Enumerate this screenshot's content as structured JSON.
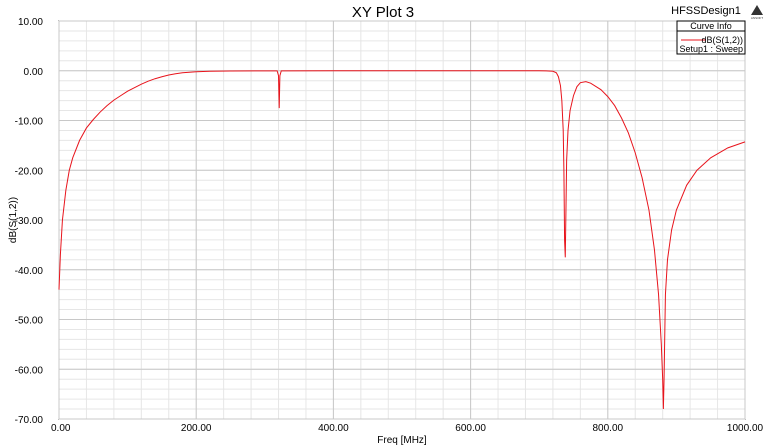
{
  "design_name": "HFSSDesign1",
  "logo_text": "ANSOFT",
  "colors": {
    "background": "#ffffff",
    "plot_bg": "#ffffff",
    "grid": "#c8c8c8",
    "curve": "#e8141c",
    "frame": "#000000"
  },
  "legend": {
    "title": "Curve Info",
    "entries": [
      {
        "name": "dB(S(1,2))",
        "setup": "Setup1 : Sweep",
        "color": "#e8141c"
      }
    ]
  },
  "chart_data": {
    "type": "line",
    "title": "XY Plot 3",
    "xlabel": "Freq [MHz]",
    "ylabel": "dB(S(1,2))",
    "xlim": [
      0,
      1000
    ],
    "ylim": [
      -70,
      10
    ],
    "xticks": [
      0,
      200,
      400,
      600,
      800,
      1000
    ],
    "xtick_labels": [
      "0.00",
      "200.00",
      "400.00",
      "600.00",
      "800.00",
      "1000.00"
    ],
    "yticks": [
      10,
      0,
      -10,
      -20,
      -30,
      -40,
      -50,
      -60,
      -70
    ],
    "ytick_labels": [
      "10.00",
      "0.00",
      "-10.00",
      "-20.00",
      "-30.00",
      "-40.00",
      "-50.00",
      "-60.00",
      "-70.00"
    ],
    "grid": true,
    "legend_position": "top-right",
    "series": [
      {
        "name": "dB(S(1,2))",
        "color": "#e8141c",
        "points": [
          [
            0,
            -44
          ],
          [
            2,
            -37
          ],
          [
            5,
            -30
          ],
          [
            10,
            -24
          ],
          [
            15,
            -20
          ],
          [
            20,
            -17.5
          ],
          [
            30,
            -14
          ],
          [
            40,
            -11.5
          ],
          [
            50,
            -9.8
          ],
          [
            60,
            -8.3
          ],
          [
            70,
            -7
          ],
          [
            80,
            -5.9
          ],
          [
            90,
            -5
          ],
          [
            100,
            -4.1
          ],
          [
            110,
            -3.4
          ],
          [
            120,
            -2.7
          ],
          [
            130,
            -2.1
          ],
          [
            140,
            -1.6
          ],
          [
            150,
            -1.2
          ],
          [
            160,
            -0.85
          ],
          [
            170,
            -0.6
          ],
          [
            180,
            -0.4
          ],
          [
            200,
            -0.2
          ],
          [
            220,
            -0.1
          ],
          [
            250,
            -0.05
          ],
          [
            300,
            -0.02
          ],
          [
            318,
            -0.02
          ],
          [
            320,
            -1
          ],
          [
            321,
            -7.5
          ],
          [
            322,
            -1
          ],
          [
            324,
            -0.02
          ],
          [
            400,
            0
          ],
          [
            500,
            0
          ],
          [
            600,
            0
          ],
          [
            700,
            0
          ],
          [
            710,
            -0.02
          ],
          [
            720,
            -0.1
          ],
          [
            725,
            -0.4
          ],
          [
            728,
            -1.2
          ],
          [
            731,
            -3
          ],
          [
            733,
            -6
          ],
          [
            735,
            -12
          ],
          [
            736,
            -20
          ],
          [
            737,
            -34
          ],
          [
            738,
            -37.5
          ],
          [
            739,
            -28
          ],
          [
            740,
            -18
          ],
          [
            742,
            -12
          ],
          [
            745,
            -8
          ],
          [
            750,
            -5
          ],
          [
            755,
            -3.2
          ],
          [
            760,
            -2.4
          ],
          [
            768,
            -2.2
          ],
          [
            775,
            -2.5
          ],
          [
            790,
            -3.8
          ],
          [
            800,
            -5.2
          ],
          [
            810,
            -7
          ],
          [
            820,
            -9.5
          ],
          [
            830,
            -12.5
          ],
          [
            840,
            -16.5
          ],
          [
            850,
            -21.5
          ],
          [
            860,
            -28
          ],
          [
            868,
            -36
          ],
          [
            874,
            -45
          ],
          [
            878,
            -55
          ],
          [
            880,
            -62
          ],
          [
            881,
            -68
          ],
          [
            882,
            -62
          ],
          [
            884,
            -45
          ],
          [
            887,
            -38
          ],
          [
            893,
            -32
          ],
          [
            900,
            -28
          ],
          [
            915,
            -23
          ],
          [
            930,
            -20
          ],
          [
            950,
            -17.5
          ],
          [
            975,
            -15.5
          ],
          [
            1000,
            -14.3
          ]
        ]
      }
    ]
  }
}
